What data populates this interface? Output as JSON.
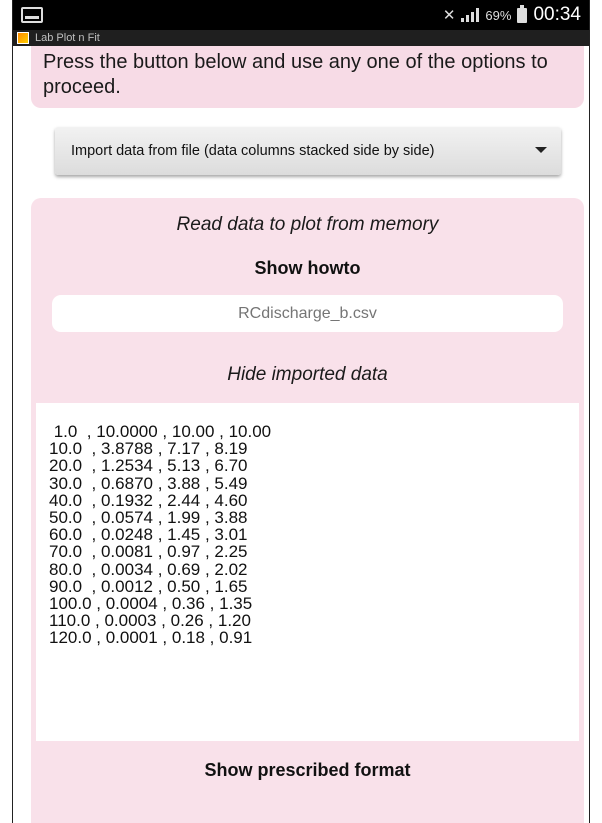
{
  "status_bar": {
    "battery_percent": "69%",
    "time": "00:34",
    "icons": [
      "screen-icon",
      "mute-icon",
      "signal-icon",
      "battery-icon"
    ]
  },
  "app": {
    "title": "Lab Plot n Fit"
  },
  "intro": {
    "text": "Press the button below and use any one of the options to proceed."
  },
  "import_dropdown": {
    "selected": "Import data from file (data columns stacked side by side)"
  },
  "panel": {
    "read_label": "Read data to plot from memory",
    "howto_button": "Show howto",
    "file_field_placeholder": "RCdischarge_b.csv",
    "hide_data_button": "Hide imported data",
    "data_lines": [
      " 1.0  , 10.0000 , 10.00 , 10.00",
      "10.0  , 3.8788 , 7.17 , 8.19",
      "20.0  , 1.2534 , 5.13 , 6.70",
      "30.0  , 0.6870 , 3.88 , 5.49",
      "40.0  , 0.1932 , 2.44 , 4.60",
      "50.0  , 0.0574 , 1.99 , 3.88",
      "60.0  , 0.0248 , 1.45 , 3.01",
      "70.0  , 0.0081 , 0.97 , 2.25",
      "80.0  , 0.0034 , 0.69 , 2.02",
      "90.0  , 0.0012 , 0.50 , 1.65",
      "100.0 , 0.0004 , 0.36 , 1.35",
      "110.0 , 0.0003 , 0.26 , 1.20",
      "120.0 , 0.0001 , 0.18 , 0.91"
    ],
    "format_button": "Show prescribed format"
  },
  "colors": {
    "panel_background": "#f9e1ea",
    "intro_background": "#f7dbe6",
    "status_bar": "#000000"
  }
}
